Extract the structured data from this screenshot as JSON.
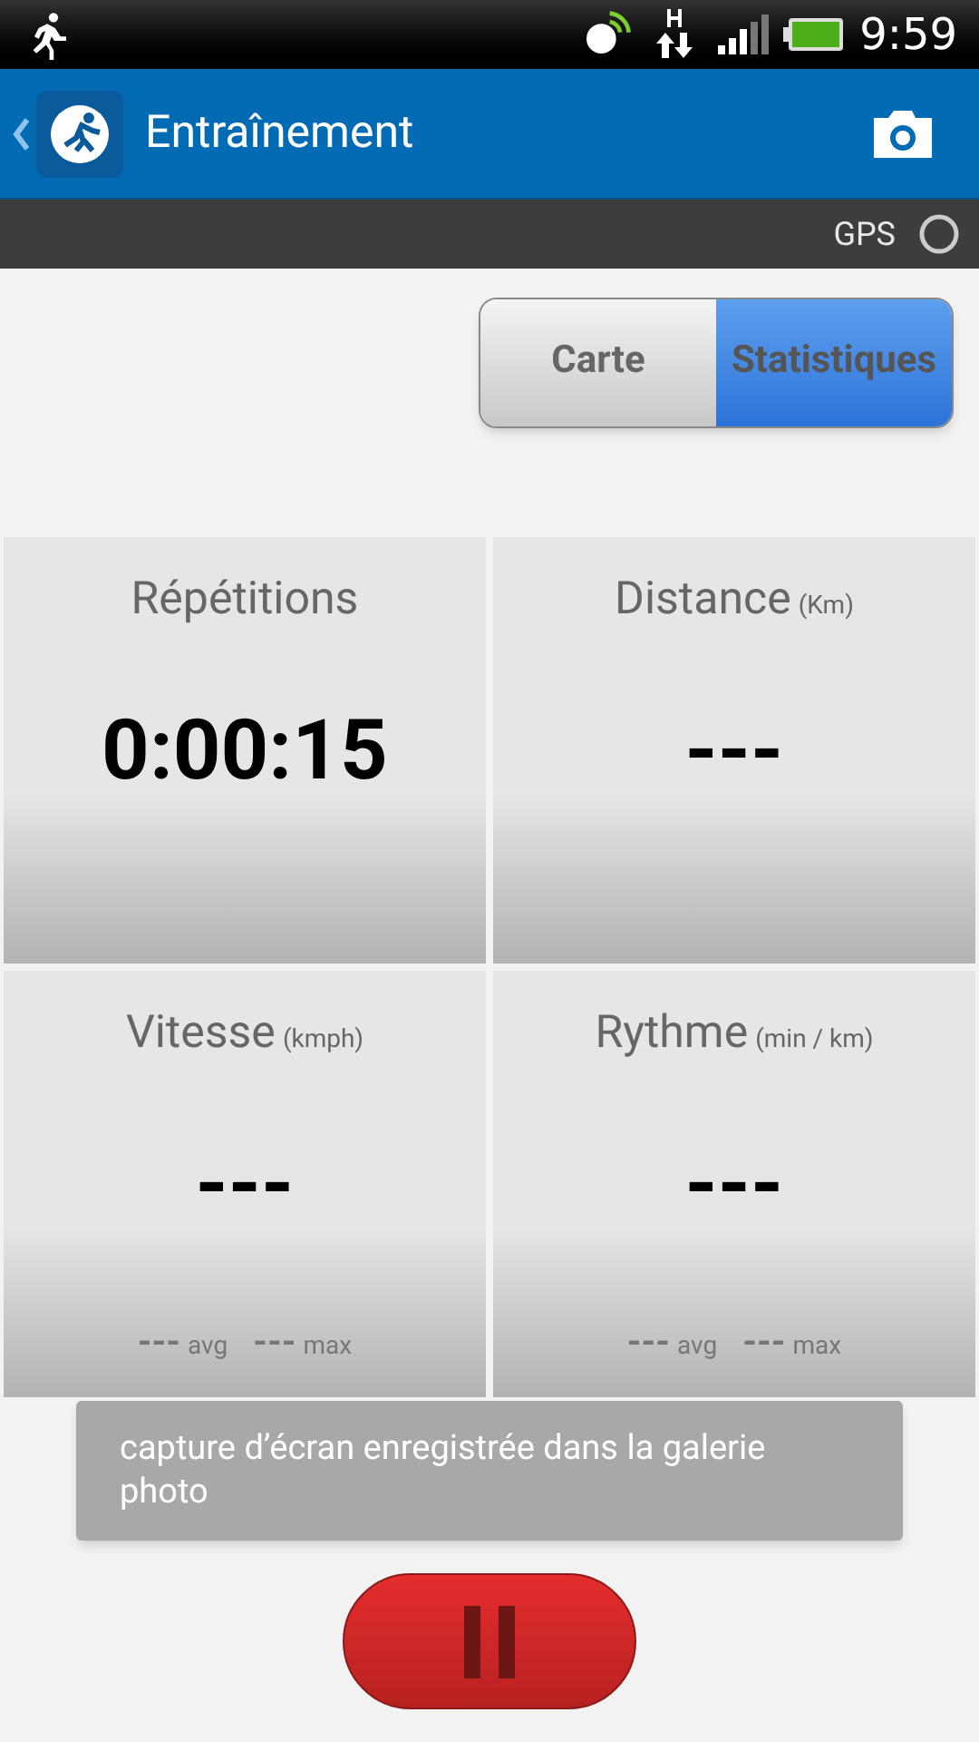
{
  "status_bar": {
    "time": "9:59"
  },
  "app_bar": {
    "title": "Entraînement"
  },
  "gps_bar": {
    "label": "GPS"
  },
  "view_toggle": [
    {
      "label": "Carte",
      "selected": false
    },
    {
      "label": "Statistiques",
      "selected": true
    }
  ],
  "tiles": [
    {
      "title": "Répétitions",
      "value": "0:00:15"
    },
    {
      "title": "Distance",
      "unit": "(Km)",
      "value": "---"
    },
    {
      "title": "Vitesse",
      "unit": "(kmph)",
      "value": "---",
      "stats": [
        {
          "value": "---",
          "label": "avg"
        },
        {
          "value": "---",
          "label": "max"
        }
      ]
    },
    {
      "title": "Rythme",
      "unit": "(min / km)",
      "value": "---",
      "stats": [
        {
          "value": "---",
          "label": "avg"
        },
        {
          "value": "---",
          "label": "max"
        }
      ]
    }
  ],
  "toast": {
    "text": "capture d’écran enregistrée dans la galerie photo"
  }
}
